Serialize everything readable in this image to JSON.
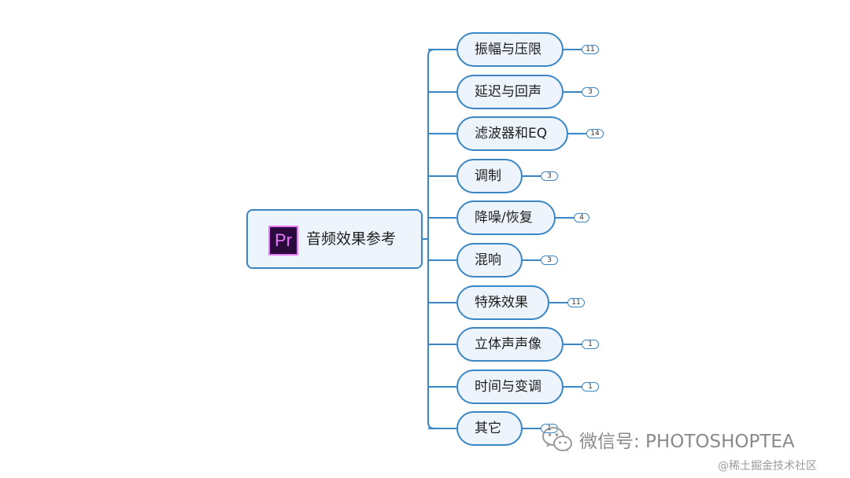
{
  "root": {
    "logo_text": "Pr",
    "label": "音频效果参考"
  },
  "branches": [
    {
      "label": "振幅与压限",
      "count": "11"
    },
    {
      "label": "延迟与回声",
      "count": "3"
    },
    {
      "label": "滤波器和EQ",
      "count": "14"
    },
    {
      "label": "调制",
      "count": "3"
    },
    {
      "label": "降噪/恢复",
      "count": "4"
    },
    {
      "label": "混响",
      "count": "3"
    },
    {
      "label": "特殊效果",
      "count": "11"
    },
    {
      "label": "立体声声像",
      "count": "1"
    },
    {
      "label": "时间与变调",
      "count": "1"
    },
    {
      "label": "其它",
      "count": "1"
    }
  ],
  "watermark": {
    "icon": "wechat-icon",
    "text": "微信号: PHOTOSHOPTEA"
  },
  "credit": "@稀土掘金技术社区",
  "colors": {
    "node_border": "#3a86c4",
    "node_fill": "#edf4fb",
    "logo_bg": "#2a0a3d",
    "logo_accent": "#ea77ff",
    "watermark": "#8a8a8a"
  }
}
